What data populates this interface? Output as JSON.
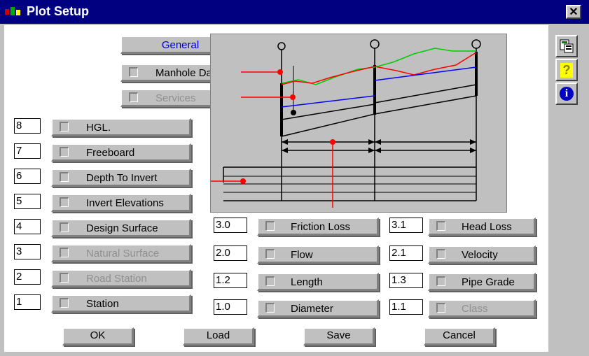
{
  "window": {
    "title": "Plot Setup",
    "close_label": "✕"
  },
  "tabs": {
    "general": "General",
    "manhole": "Manhole Data",
    "services": "Services"
  },
  "left_rows": [
    {
      "num": "8",
      "label": "HGL."
    },
    {
      "num": "7",
      "label": "Freeboard"
    },
    {
      "num": "6",
      "label": "Depth To Invert"
    },
    {
      "num": "5",
      "label": "Invert Elevations"
    },
    {
      "num": "4",
      "label": "Design Surface"
    },
    {
      "num": "3",
      "label": "Natural Surface"
    },
    {
      "num": "2",
      "label": "Road Station"
    },
    {
      "num": "1",
      "label": "Station"
    }
  ],
  "mid_rows": [
    {
      "num": "3.0",
      "label": "Friction Loss"
    },
    {
      "num": "2.0",
      "label": "Flow"
    },
    {
      "num": "1.2",
      "label": "Length"
    },
    {
      "num": "1.0",
      "label": "Diameter"
    }
  ],
  "right_rows": [
    {
      "num": "3.1",
      "label": "Head Loss"
    },
    {
      "num": "2.1",
      "label": "Velocity"
    },
    {
      "num": "1.3",
      "label": "Pipe Grade"
    },
    {
      "num": "1.1",
      "label": "Class"
    }
  ],
  "buttons": {
    "ok": "OK",
    "load": "Load",
    "save": "Save",
    "cancel": "Cancel"
  },
  "toolbar": {
    "icons": [
      "export-icon",
      "help-icon",
      "info-icon"
    ],
    "help_glyph": "?",
    "info_glyph": "i"
  },
  "colors": {
    "title_bar": "#000080",
    "hgl": "#ff0000",
    "surface": "#00cc00",
    "invert": "#0000ff",
    "general_text": "#0000c0"
  }
}
